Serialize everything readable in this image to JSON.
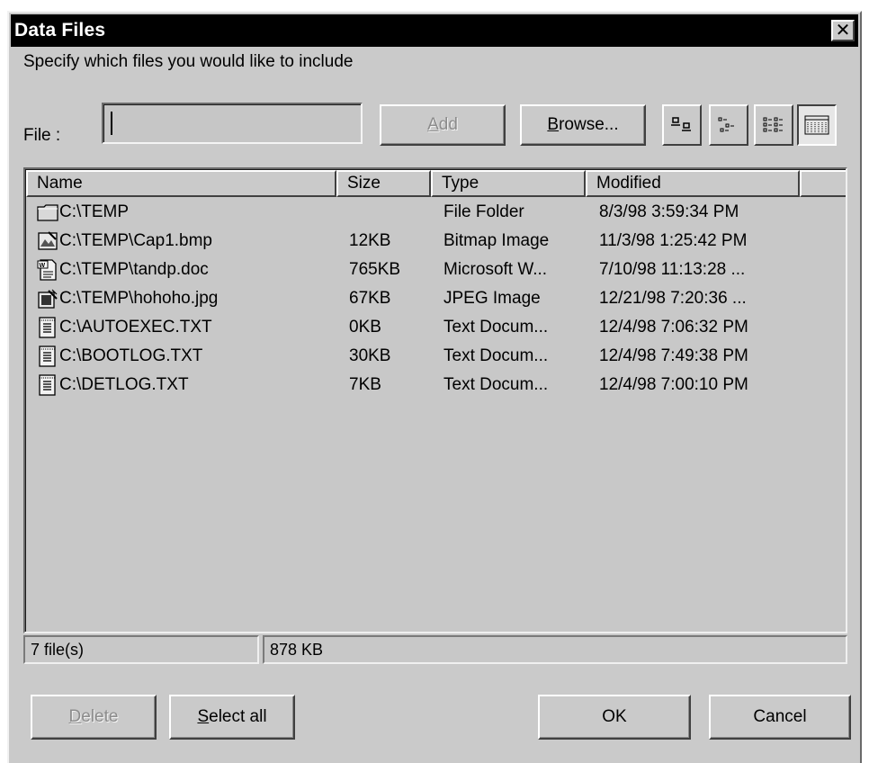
{
  "window": {
    "title": "Data Files",
    "close_icon": "close-icon"
  },
  "prompt": "Specify which files you would like to include",
  "file_field": {
    "label": "File :",
    "value": ""
  },
  "buttons": {
    "add": {
      "label": "Add",
      "accel": "A",
      "rest": "dd",
      "enabled": false
    },
    "browse": {
      "label": "Browse...",
      "accel": "B",
      "rest": "rowse...",
      "enabled": true
    },
    "delete": {
      "label": "Delete",
      "accel": "D",
      "rest": "elete",
      "enabled": false
    },
    "select_all": {
      "label": "Select all",
      "accel": "S",
      "rest": "elect all",
      "enabled": true
    },
    "ok": {
      "label": "OK",
      "enabled": true
    },
    "cancel": {
      "label": "Cancel",
      "enabled": true
    }
  },
  "view_modes": [
    {
      "name": "large-icons-view-icon",
      "pressed": false
    },
    {
      "name": "small-icons-view-icon",
      "pressed": false
    },
    {
      "name": "list-view-icon",
      "pressed": false
    },
    {
      "name": "details-view-icon",
      "pressed": true
    }
  ],
  "table": {
    "columns": [
      "Name",
      "Size",
      "Type",
      "Modified"
    ],
    "rows": [
      {
        "icon": "folder-icon",
        "name": "C:\\TEMP",
        "size": "",
        "type": "File Folder",
        "modified": "8/3/98 3:59:34 PM"
      },
      {
        "icon": "bitmap-image-icon",
        "name": "C:\\TEMP\\Cap1.bmp",
        "size": "12KB",
        "type": "Bitmap Image",
        "modified": "11/3/98 1:25:42 PM"
      },
      {
        "icon": "word-document-icon",
        "name": "C:\\TEMP\\tandp.doc",
        "size": "765KB",
        "type": "Microsoft W...",
        "modified": "7/10/98 11:13:28 ..."
      },
      {
        "icon": "jpeg-image-icon",
        "name": "C:\\TEMP\\hohoho.jpg",
        "size": "67KB",
        "type": "JPEG Image",
        "modified": "12/21/98 7:20:36 ..."
      },
      {
        "icon": "text-document-icon",
        "name": "C:\\AUTOEXEC.TXT",
        "size": "0KB",
        "type": "Text Docum...",
        "modified": "12/4/98 7:06:32 PM"
      },
      {
        "icon": "text-document-icon",
        "name": "C:\\BOOTLOG.TXT",
        "size": "30KB",
        "type": "Text Docum...",
        "modified": "12/4/98 7:49:38 PM"
      },
      {
        "icon": "text-document-icon",
        "name": "C:\\DETLOG.TXT",
        "size": "7KB",
        "type": "Text Docum...",
        "modified": "12/4/98 7:00:10 PM"
      }
    ]
  },
  "status": {
    "file_count": "7 file(s)",
    "total_size": "878 KB"
  }
}
